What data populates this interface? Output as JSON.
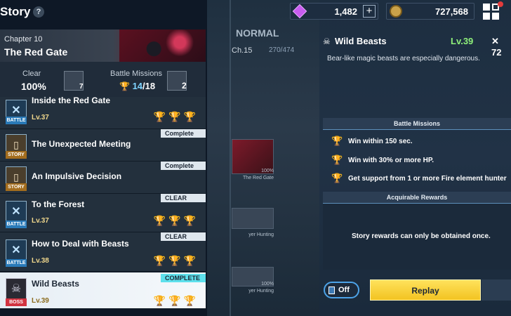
{
  "header": {
    "title": "Story",
    "help_icon": "?",
    "gems": "1,482",
    "gold": "727,568"
  },
  "chapter": {
    "label": "Chapter 10",
    "name": "The Red Gate"
  },
  "stats": {
    "clear_label": "Clear",
    "clear_value": "100%",
    "clear_box_count": "7",
    "missions_label": "Battle Missions",
    "missions_done": "14",
    "missions_total": "/18",
    "missions_box_count": "2"
  },
  "missions": [
    {
      "name": "Inside the Red Gate",
      "type": "BATTLE",
      "level": "Lv.37",
      "status": "",
      "trophies": [
        true,
        true,
        true
      ],
      "selected": false
    },
    {
      "name": "The Unexpected Meeting",
      "type": "STORY",
      "level": "",
      "status": "Complete",
      "trophies": [],
      "selected": false
    },
    {
      "name": "An Impulsive Decision",
      "type": "STORY",
      "level": "",
      "status": "Complete",
      "trophies": [],
      "selected": false
    },
    {
      "name": "To the Forest",
      "type": "BATTLE",
      "level": "Lv.37",
      "status": "CLEAR",
      "trophies": [
        false,
        true,
        false
      ],
      "selected": false
    },
    {
      "name": "How to Deal with Beasts",
      "type": "BATTLE",
      "level": "Lv.38",
      "status": "CLEAR",
      "trophies": [
        false,
        true,
        true
      ],
      "selected": false
    },
    {
      "name": "Wild Beasts",
      "type": "BOSS",
      "level": "Lv.39",
      "status": "COMPLETE",
      "trophies": [
        true,
        true,
        true
      ],
      "selected": true
    }
  ],
  "stage_map": {
    "difficulty": "NORMAL",
    "chapter": "Ch.15",
    "progress": "270/474",
    "thumb_caption_1": "The Red Gate",
    "thumb_pct": "100%",
    "thumb_caption_2": "yer Hunting",
    "thumb_caption_3": "yer Hunting"
  },
  "detail": {
    "title": "Wild Beasts",
    "level": "Lv.39",
    "power": "72",
    "description": "Bear-like magic beasts are especially dangerous.",
    "battle_missions_header": "Battle Missions",
    "battle_missions": [
      "Win within 150 sec.",
      "Win with 30% or more HP.",
      "Get support from 1 or more Fire element hunter"
    ],
    "rewards_header": "Acquirable Rewards",
    "rewards_message": "Story rewards can only be obtained once.",
    "toggle_label": "Off",
    "replay_label": "Replay"
  },
  "colors": {
    "accent_cyan": "#5ee0ec",
    "gold": "#f2c43a",
    "level_green": "#8ff07a",
    "replay_yellow": "#f2c321"
  }
}
